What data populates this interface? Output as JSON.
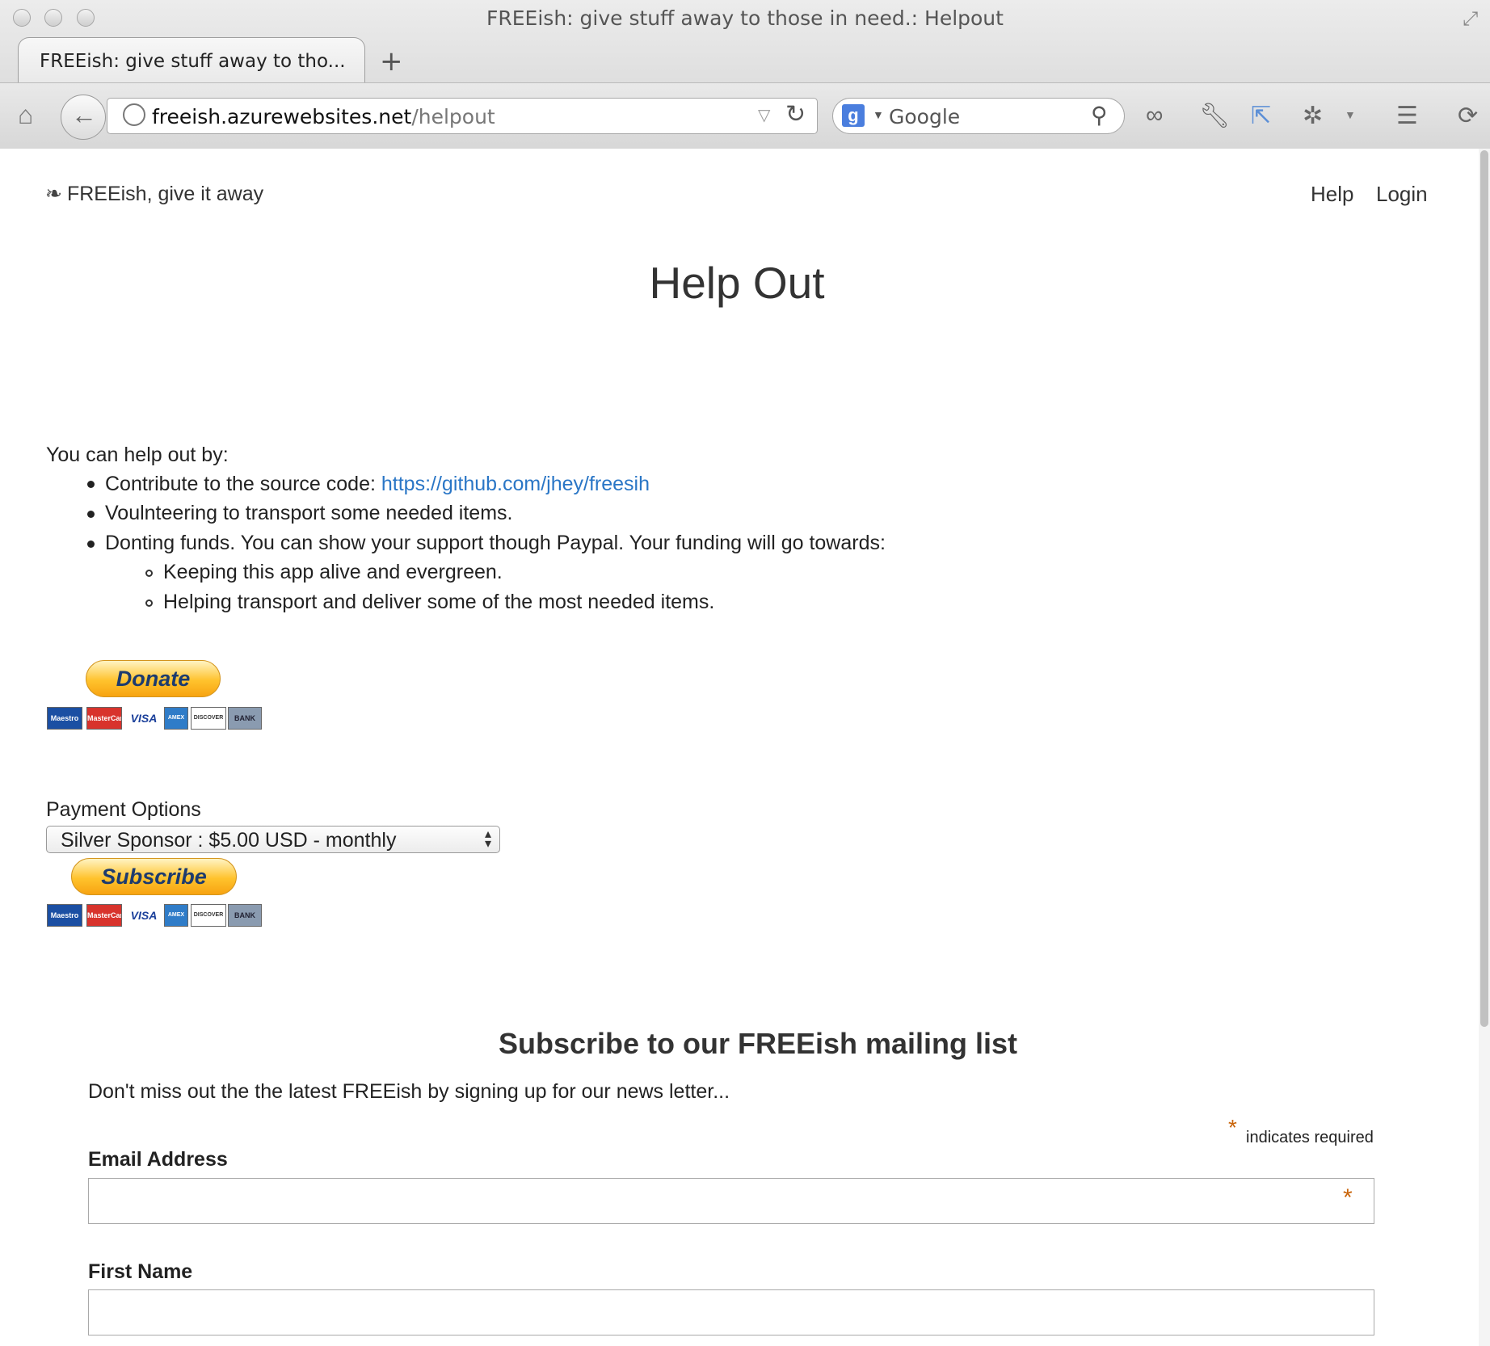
{
  "window": {
    "title": "FREEish: give stuff away to those in need.: Helpout",
    "tab_label": "FREEish: give stuff away to tho...",
    "new_tab": "+"
  },
  "toolbar": {
    "url_host": "freeish.azurewebsites.net",
    "url_path": "/helpout",
    "search_engine": "Google",
    "search_placeholder": "Google",
    "icons": [
      "home-icon",
      "back-icon",
      "globe-icon",
      "dropdown-icon",
      "reload-icon",
      "google-icon",
      "search-icon",
      "mask-icon",
      "wrench-icon",
      "cursor-icon",
      "puzzle-icon",
      "menu-icon",
      "sync-icon"
    ]
  },
  "nav": {
    "brand": "FREEish, give it away",
    "links": [
      {
        "label": "Help"
      },
      {
        "label": "Login"
      }
    ]
  },
  "main": {
    "title": "Help Out",
    "intro": "You can help out by:",
    "items": [
      {
        "text": "Contribute to the source code: ",
        "link": "https://github.com/jhey/freesih"
      },
      {
        "text": "Voulnteering to transport some needed items."
      },
      {
        "text": "Donting funds. You can show your support though Paypal. Your funding will go towards:"
      }
    ],
    "subitems": [
      {
        "text": "Keeping this app alive and evergreen."
      },
      {
        "text": "Helping transport and deliver some of the most needed items."
      }
    ],
    "donate_label": "Donate",
    "cards": [
      "Maestro",
      "MasterCard",
      "VISA",
      "AMEX",
      "DISCOVER",
      "BANK"
    ],
    "payment_label": "Payment Options",
    "payment_selected": "Silver Sponsor : $5.00 USD - monthly",
    "subscribe_label": "Subscribe"
  },
  "mailing": {
    "title": "Subscribe to our FREEish mailing list",
    "subtitle": "Don't miss out the the latest FREEish by signing up for our news letter...",
    "required_mark": "*",
    "required_text": "indicates required",
    "email_label": "Email Address",
    "first_name_label": "First Name"
  },
  "colors": {
    "link": "#2a76c6",
    "required": "#c9650b",
    "paypal_gold": "#ffc32d",
    "paypal_text": "#1d3b6e"
  }
}
